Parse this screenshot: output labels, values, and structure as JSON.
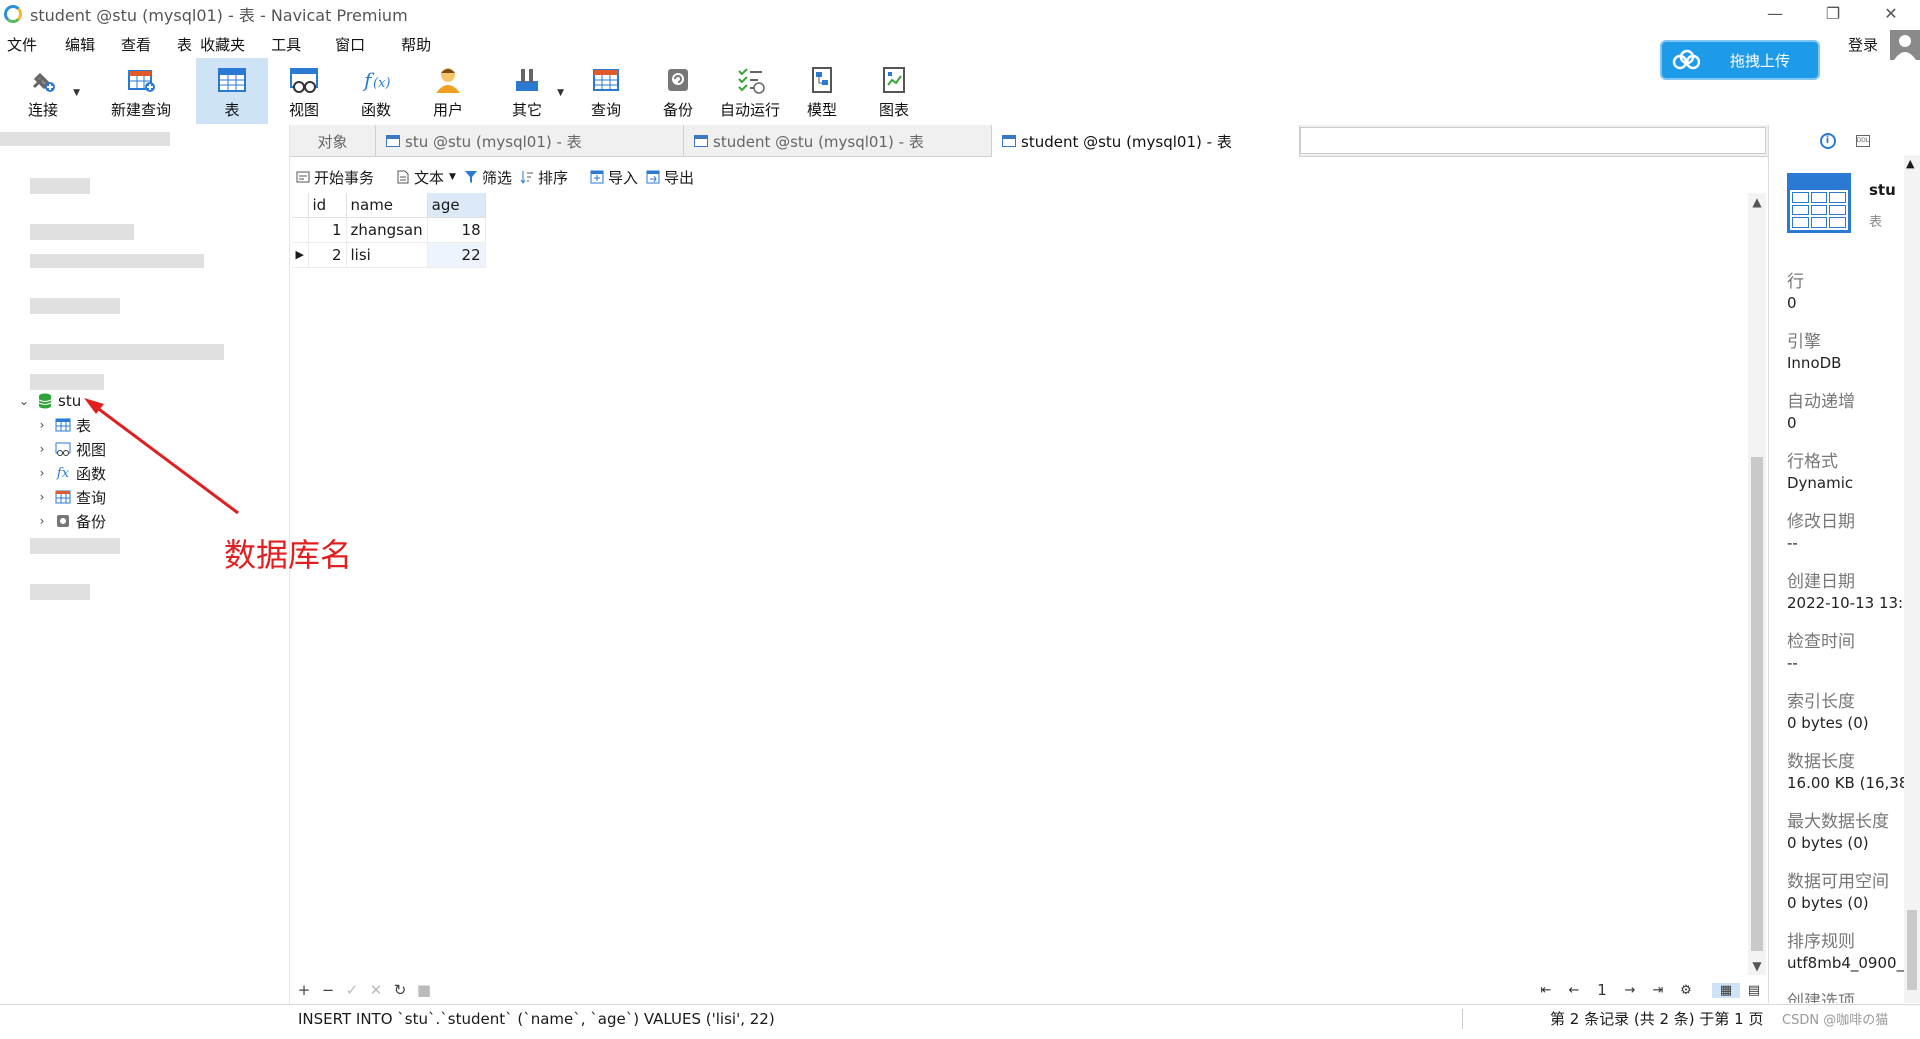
{
  "window": {
    "title": "student @stu (mysql01) - 表 - Navicat Premium",
    "controls": [
      "—",
      "❐",
      "✕"
    ]
  },
  "menu": [
    "文件",
    "编辑",
    "查看",
    "表",
    "收藏夹",
    "工具",
    "窗口",
    "帮助"
  ],
  "toolbar": [
    {
      "label": "连接",
      "icon": "plug-icon",
      "dropdown": true
    },
    {
      "label": "新建查询",
      "icon": "new-query-icon",
      "dropdown": false
    },
    {
      "label": "表",
      "icon": "table-icon",
      "dropdown": false,
      "active": true
    },
    {
      "label": "视图",
      "icon": "view-icon",
      "dropdown": false
    },
    {
      "label": "函数",
      "icon": "function-icon",
      "dropdown": false
    },
    {
      "label": "用户",
      "icon": "user-icon",
      "dropdown": false
    },
    {
      "label": "其它",
      "icon": "tools-icon",
      "dropdown": true
    },
    {
      "label": "查询",
      "icon": "query-icon",
      "dropdown": false
    },
    {
      "label": "备份",
      "icon": "backup-icon",
      "dropdown": false
    },
    {
      "label": "自动运行",
      "icon": "autorun-icon",
      "dropdown": false
    },
    {
      "label": "模型",
      "icon": "model-icon",
      "dropdown": false
    },
    {
      "label": "图表",
      "icon": "chart-icon",
      "dropdown": false
    }
  ],
  "upload": {
    "label": "拖拽上传"
  },
  "account": {
    "login": "登录"
  },
  "tree": {
    "database": "stu",
    "children": [
      "表",
      "视图",
      "函数",
      "查询",
      "备份"
    ]
  },
  "annotation": {
    "text": "数据库名",
    "color": "#e02020"
  },
  "tabs": [
    {
      "label": "对象",
      "icon": false,
      "active": false
    },
    {
      "label": "stu @stu (mysql01) - 表",
      "icon": true,
      "active": false
    },
    {
      "label": "student @stu (mysql01) - 表",
      "icon": true,
      "active": false
    },
    {
      "label": "student @stu (mysql01) - 表",
      "icon": true,
      "active": true
    }
  ],
  "actions": [
    "开始事务",
    "文本",
    "筛选",
    "排序",
    "导入",
    "导出"
  ],
  "grid": {
    "columns": [
      "id",
      "name",
      "age"
    ],
    "rows": [
      {
        "id": "1",
        "name": "zhangsan",
        "age": "18"
      },
      {
        "id": "2",
        "name": "lisi",
        "age": "22"
      }
    ]
  },
  "gridbar": {
    "page": "1"
  },
  "status": {
    "sql": "INSERT INTO `stu`.`student` (`name`, `age`) VALUES ('lisi', 22)",
    "records": "第 2 条记录 (共 2 条) 于第 1 页",
    "watermark": "CSDN @咖啡の猫"
  },
  "info": {
    "name": "stu",
    "type": "表",
    "props": [
      {
        "k": "行",
        "v": "0"
      },
      {
        "k": "引擎",
        "v": "InnoDB"
      },
      {
        "k": "自动递增",
        "v": "0"
      },
      {
        "k": "行格式",
        "v": "Dynamic"
      },
      {
        "k": "修改日期",
        "v": "--"
      },
      {
        "k": "创建日期",
        "v": "2022-10-13 13:"
      },
      {
        "k": "检查时间",
        "v": "--"
      },
      {
        "k": "索引长度",
        "v": "0 bytes (0)"
      },
      {
        "k": "数据长度",
        "v": "16.00 KB (16,38"
      },
      {
        "k": "最大数据长度",
        "v": "0 bytes (0)"
      },
      {
        "k": "数据可用空间",
        "v": "0 bytes (0)"
      },
      {
        "k": "排序规则",
        "v": "utf8mb4_0900_"
      },
      {
        "k": "创建选项",
        "v": ""
      }
    ]
  },
  "colors": {
    "accent": "#2a7ad4",
    "toolbar_active": "#cfe3f7",
    "upload": "#1e9be8"
  }
}
